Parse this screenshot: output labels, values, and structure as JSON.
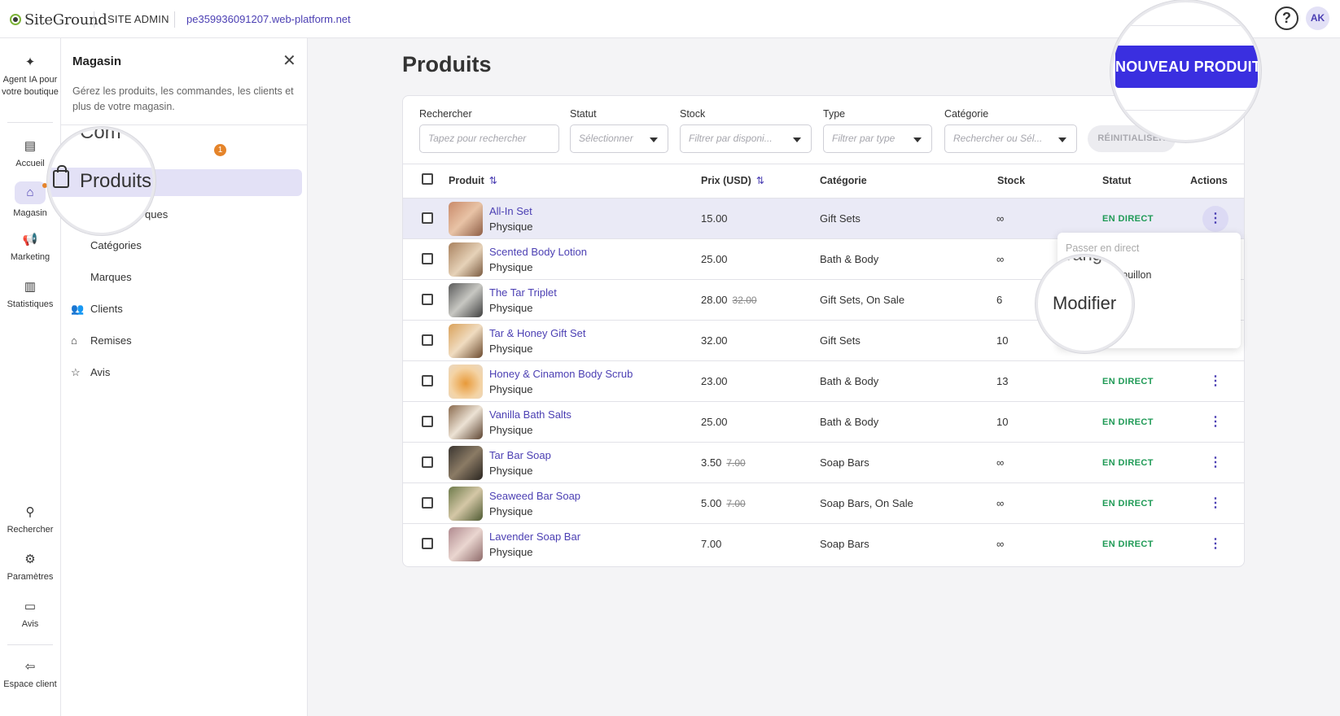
{
  "topbar": {
    "logo_text": "SiteGround",
    "site_admin": "SITE ADMIN",
    "domain": "pe359936091207.web-platform.net",
    "help": "?",
    "avatar": "AK"
  },
  "rail": {
    "items": [
      {
        "label": "Agent IA pour votre boutique",
        "icon": "sparkle-icon"
      },
      {
        "label": "Accueil",
        "icon": "dashboard-icon"
      },
      {
        "label": "Magasin",
        "icon": "store-icon"
      },
      {
        "label": "Marketing",
        "icon": "megaphone-icon"
      },
      {
        "label": "Statistiques",
        "icon": "chart-icon"
      },
      {
        "label": "Rechercher",
        "icon": "search-icon"
      },
      {
        "label": "Paramètres",
        "icon": "gear-icon"
      },
      {
        "label": "Avis",
        "icon": "feedback-icon"
      },
      {
        "label": "Espace client",
        "icon": "exit-icon"
      }
    ]
  },
  "panel": {
    "title": "Magasin",
    "description": "Gérez les produits, les commandes, les clients et plus de votre magasin.",
    "hidden_item": "Com",
    "badge": "1",
    "active_item": "Produits",
    "partial_item": "ques",
    "items": [
      "Catégories",
      "Marques",
      "Clients",
      "Remises",
      "Avis"
    ]
  },
  "main": {
    "title": "Produits",
    "new_button": "NOUVEAU PRODUIT",
    "filters": {
      "search_label": "Rechercher",
      "search_placeholder": "Tapez pour rechercher",
      "status_label": "Statut",
      "status_placeholder": "Sélectionner",
      "stock_label": "Stock",
      "stock_placeholder": "Filtrer par disponi...",
      "type_label": "Type",
      "type_placeholder": "Filtrer par type",
      "category_label": "Catégorie",
      "category_placeholder": "Rechercher ou Sél...",
      "reset": "RÉINITIALISER"
    },
    "columns": {
      "product": "Produit",
      "price": "Prix (USD)",
      "category": "Catégorie",
      "stock": "Stock",
      "status": "Statut",
      "actions": "Actions"
    },
    "rows": [
      {
        "name": "All-In Set",
        "type": "Physique",
        "price": "15.00",
        "old_price": "",
        "category": "Gift Sets",
        "stock": "∞",
        "status": "EN DIRECT"
      },
      {
        "name": "Scented Body Lotion",
        "type": "Physique",
        "price": "25.00",
        "old_price": "",
        "category": "Bath & Body",
        "stock": "∞",
        "status": ""
      },
      {
        "name": "The Tar Triplet",
        "type": "Physique",
        "price": "28.00",
        "old_price": "32.00",
        "category": "Gift Sets, On Sale",
        "stock": "6",
        "status": ""
      },
      {
        "name": "Tar & Honey Gift Set",
        "type": "Physique",
        "price": "32.00",
        "old_price": "",
        "category": "Gift Sets",
        "stock": "10",
        "status": ""
      },
      {
        "name": "Honey & Cinamon Body Scrub",
        "type": "Physique",
        "price": "23.00",
        "old_price": "",
        "category": "Bath & Body",
        "stock": "13",
        "status": "EN DIRECT"
      },
      {
        "name": "Vanilla Bath Salts",
        "type": "Physique",
        "price": "25.00",
        "old_price": "",
        "category": "Bath & Body",
        "stock": "10",
        "status": "EN DIRECT"
      },
      {
        "name": "Tar Bar Soap",
        "type": "Physique",
        "price": "3.50",
        "old_price": "7.00",
        "category": "Soap Bars",
        "stock": "∞",
        "status": "EN DIRECT"
      },
      {
        "name": "Seaweed Bar Soap",
        "type": "Physique",
        "price": "5.00",
        "old_price": "7.00",
        "category": "Soap Bars, On Sale",
        "stock": "∞",
        "status": "EN DIRECT"
      },
      {
        "name": "Lavender Soap Bar",
        "type": "Physique",
        "price": "7.00",
        "old_price": "",
        "category": "Soap Bars",
        "stock": "∞",
        "status": "EN DIRECT"
      }
    ],
    "dropdown": {
      "item1": "Passer en direct",
      "item2_partial": "rang",
      "item3_partial": "errouillon",
      "modifier": "Modifier"
    }
  },
  "colors": {
    "accent": "#4b3fb3",
    "button": "#3a2fe0",
    "live": "#1f9a56",
    "badge": "#e5842a"
  }
}
